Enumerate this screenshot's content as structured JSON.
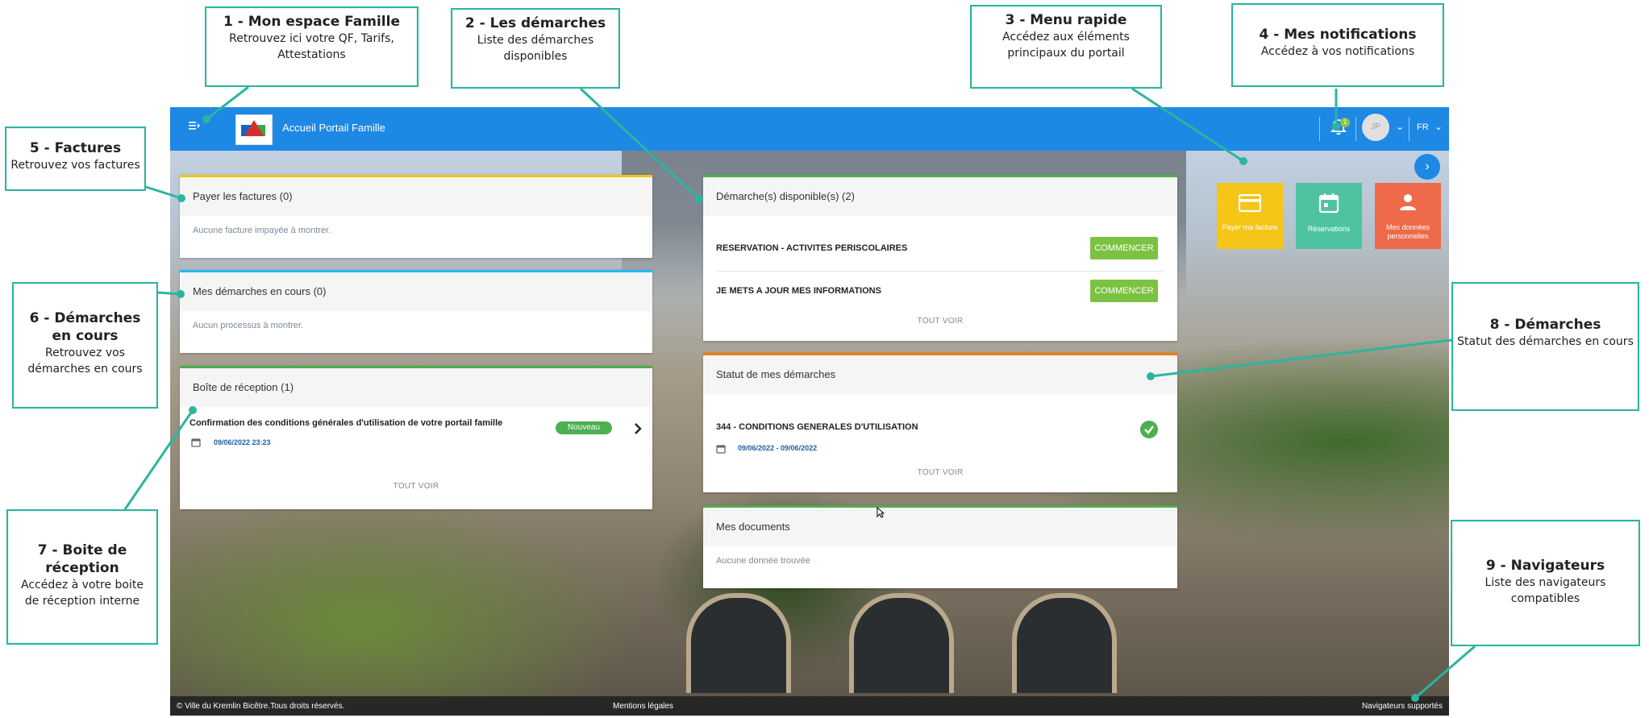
{
  "app": {
    "title": "Accueil Portail Famille",
    "language": "FR",
    "notification_count": "1",
    "avatar_initials": "JP",
    "menu_icon": "menu-open-icon",
    "bell_icon": "bell-icon"
  },
  "cards": {
    "factures": {
      "title": "Payer les factures (0)",
      "empty": "Aucune facture impayée à montrer."
    },
    "demarches_cours": {
      "title": "Mes démarches en cours (0)",
      "empty": "Aucun processus à montrer."
    },
    "boite": {
      "title": "Boîte de réception (1)",
      "message_title": "Confirmation des conditions générales d'utilisation de votre portail famille",
      "message_date": "09/06/2022 23:23",
      "badge": "Nouveau",
      "see_all": "TOUT VOIR"
    },
    "disponibles": {
      "title": "Démarche(s) disponible(s) (2)",
      "items": [
        {
          "label": "RESERVATION - ACTIVITES PERISCOLAIRES",
          "button": "COMMENCER"
        },
        {
          "label": "JE METS A JOUR MES INFORMATIONS",
          "button": "COMMENCER"
        }
      ],
      "see_all": "TOUT VOIR"
    },
    "statut": {
      "title": "Statut de mes démarches",
      "item_label": "344 - CONDITIONS GENERALES D'UTILISATION",
      "item_dates": "09/06/2022 - 09/06/2022",
      "see_all": "TOUT VOIR"
    },
    "documents": {
      "title": "Mes documents",
      "empty": "Aucune donnée trouvée"
    }
  },
  "quick_menu": [
    {
      "label": "Payer ma facture",
      "icon": "credit-card-icon",
      "color": "#f5c518"
    },
    {
      "label": "Réservations",
      "icon": "calendar-icon",
      "color": "#4fc3a1"
    },
    {
      "label": "Mes données personnelles",
      "icon": "person-icon",
      "color": "#ef6a4a"
    }
  ],
  "footer": {
    "copyright": "© Ville du Kremlin Bicêtre.Tous droits réservés.",
    "legal": "Mentions légales",
    "browsers": "Navigateurs supportés"
  },
  "callouts": [
    {
      "title": "1 - Mon espace Famille",
      "desc": "Retrouvez ici votre QF, Tarifs, Attestations"
    },
    {
      "title": "2 - Les démarches",
      "desc": "Liste des démarches disponibles"
    },
    {
      "title": "3 - Menu rapide",
      "desc": "Accédez aux éléments principaux du portail"
    },
    {
      "title": "4 - Mes notifications",
      "desc": "Accédez à vos notifications"
    },
    {
      "title": "5 - Factures",
      "desc": "Retrouvez vos factures"
    },
    {
      "title": "6 - Démarches en cours",
      "desc": "Retrouvez vos démarches en cours"
    },
    {
      "title": "7 - Boite de réception",
      "desc": "Accédez à votre boite de réception interne"
    },
    {
      "title": "8 - Démarches",
      "desc": "Statut des démarches en cours"
    },
    {
      "title": "9 - Navigateurs",
      "desc": "Liste des navigateurs compatibles"
    }
  ],
  "colors": {
    "topbar": "#1e88e5",
    "callout_border": "#2bb5a0",
    "success": "#4caf50",
    "button_green": "#7cc242"
  }
}
